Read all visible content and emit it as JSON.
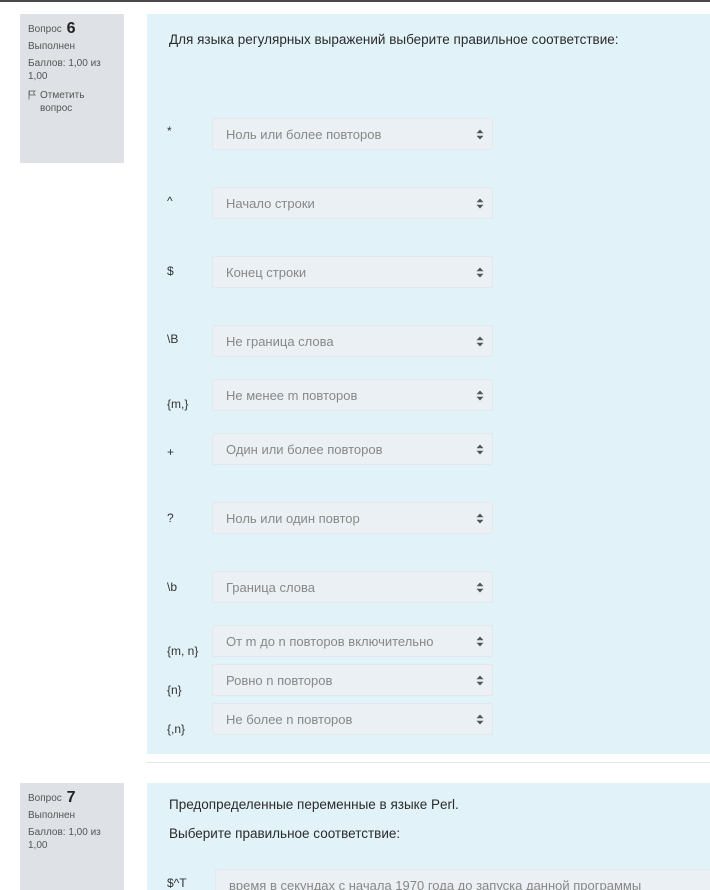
{
  "questions": [
    {
      "label": "Вопрос",
      "number": "6",
      "status": "Выполнен",
      "grade": "Баллов: 1,00 из 1,00",
      "flag": "Отметить вопрос",
      "text": "Для языка регулярных выражений выберите правильное соответствие:",
      "pairs": [
        {
          "stem": "*",
          "answer": "Ноль или более повторов"
        },
        {
          "stem": "^",
          "answer": "Начало строки"
        },
        {
          "stem": "$",
          "answer": "Конец строки"
        },
        {
          "stem": "\\B",
          "answer": "Не граница слова"
        },
        {
          "stem": "{m,}",
          "answer": "Не менее m повторов"
        },
        {
          "stem": "+",
          "answer": "Один или более повторов"
        },
        {
          "stem": "?",
          "answer": "Ноль или один повтор"
        },
        {
          "stem": "\\b",
          "answer": "Граница слова"
        },
        {
          "stem": "{m, n}",
          "answer": "От m до n повторов включительно"
        },
        {
          "stem": "{n}",
          "answer": "Ровно n повторов"
        },
        {
          "stem": "{,n}",
          "answer": "Не более n повторов"
        }
      ]
    },
    {
      "label": "Вопрос",
      "number": "7",
      "status": "Выполнен",
      "grade": "Баллов: 1,00 из 1,00",
      "text_line1": "Предопределенные переменные в языке Perl.",
      "text_line2": "Выберите правильное соответствие:",
      "pairs": [
        {
          "stem": "$^T",
          "answer": "время в секундах с начала 1970 года до запуска данной программы"
        }
      ]
    }
  ],
  "colors": {
    "info_bg": "#dee2e6",
    "content_bg": "#e1f2f8",
    "select_bg": "#eaf0f3"
  },
  "icons": {
    "flag": "flag-icon",
    "select_arrow": "up-down-arrows-icon"
  }
}
